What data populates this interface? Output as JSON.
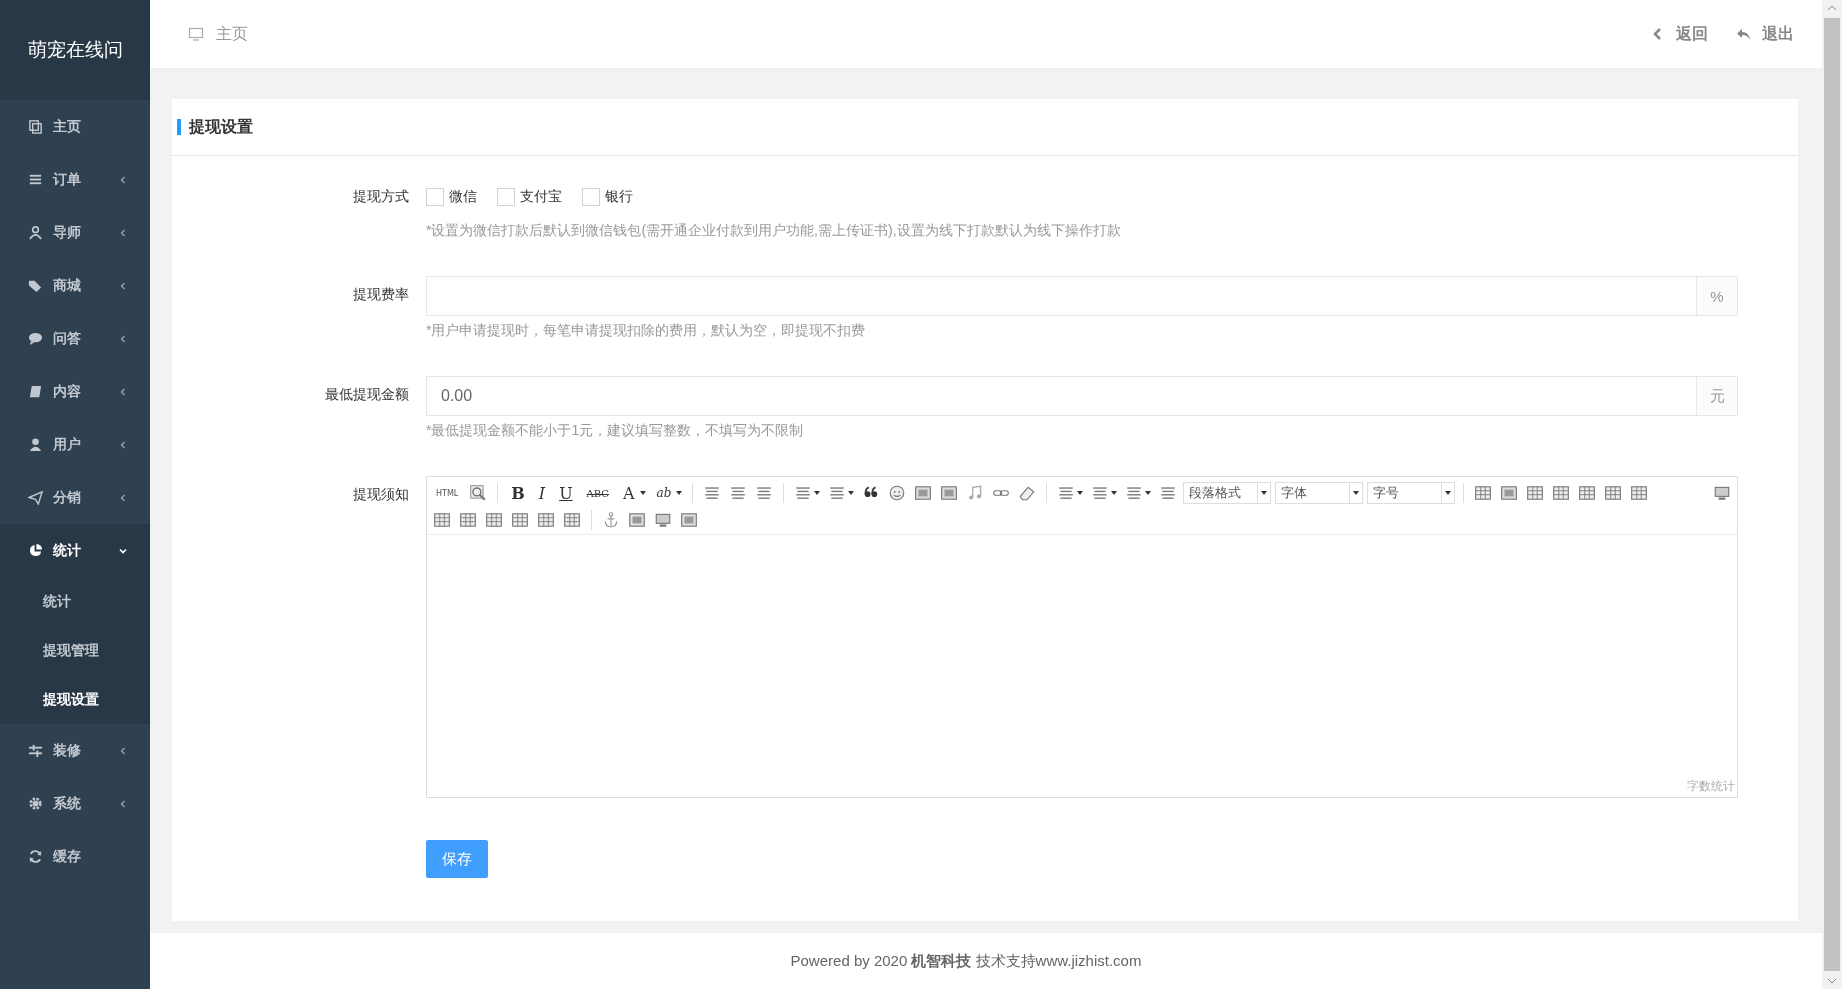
{
  "sidebar": {
    "brand": "萌宠在线问",
    "items": [
      {
        "label": "主页",
        "expandable": false,
        "selected": false
      },
      {
        "label": "订单",
        "expandable": true,
        "expanded": false,
        "selected": false
      },
      {
        "label": "导师",
        "expandable": true,
        "expanded": false,
        "selected": false
      },
      {
        "label": "商城",
        "expandable": true,
        "expanded": false,
        "selected": false
      },
      {
        "label": "问答",
        "expandable": true,
        "expanded": false,
        "selected": false
      },
      {
        "label": "内容",
        "expandable": true,
        "expanded": false,
        "selected": false
      },
      {
        "label": "用户",
        "expandable": true,
        "expanded": false,
        "selected": false
      },
      {
        "label": "分销",
        "expandable": true,
        "expanded": false,
        "selected": false
      },
      {
        "label": "统计",
        "expandable": true,
        "expanded": true,
        "selected": true,
        "children": [
          {
            "label": "统计",
            "selected": false
          },
          {
            "label": "提现管理",
            "selected": false
          },
          {
            "label": "提现设置",
            "selected": true
          }
        ]
      },
      {
        "label": "装修",
        "expandable": true,
        "expanded": false,
        "selected": false
      },
      {
        "label": "系统",
        "expandable": true,
        "expanded": false,
        "selected": false
      },
      {
        "label": "缓存",
        "expandable": false,
        "selected": false
      }
    ]
  },
  "header": {
    "breadcrumb": "主页",
    "back": "返回",
    "logout": "退出"
  },
  "card": {
    "title": "提现设置",
    "method": {
      "label": "提现方式",
      "options": [
        {
          "label": "微信",
          "checked": false
        },
        {
          "label": "支付宝",
          "checked": false
        },
        {
          "label": "银行",
          "checked": false
        }
      ],
      "hint": "*设置为微信打款后默认到微信钱包(需开通企业付款到用户功能,需上传证书),设置为线下打款默认为线下操作打款"
    },
    "fee": {
      "label": "提现费率",
      "suffix": "%",
      "hint": "*用户申请提现时，每笔申请提现扣除的费用，默认为空，即提现不扣费"
    },
    "min": {
      "label": "最低提现金额",
      "value": "0.00",
      "suffix": "元",
      "hint": "*最低提现金额不能小于1元，建议填写整数，不填写为不限制"
    },
    "notice": {
      "label": "提现须知",
      "word_count": "字数统计",
      "toolbar": [
        [
          {
            "kind": "glyph",
            "text": "HTML"
          },
          {
            "kind": "icon"
          },
          {
            "kind": "sep"
          },
          {
            "kind": "glyph",
            "text": "B"
          },
          {
            "kind": "glyph",
            "text": "I"
          },
          {
            "kind": "glyph",
            "text": "U"
          },
          {
            "kind": "glyph",
            "text": "ABC"
          },
          {
            "kind": "glyph",
            "text": "A",
            "caret": true
          },
          {
            "kind": "glyph",
            "text": "ab",
            "caret": true
          },
          {
            "kind": "sep"
          },
          {
            "kind": "icon"
          },
          {
            "kind": "icon"
          },
          {
            "kind": "icon"
          },
          {
            "kind": "sep"
          },
          {
            "kind": "icon",
            "caret": true
          },
          {
            "kind": "icon",
            "caret": true
          },
          {
            "kind": "icon"
          },
          {
            "kind": "icon"
          },
          {
            "kind": "icon"
          },
          {
            "kind": "icon"
          },
          {
            "kind": "icon"
          },
          {
            "kind": "icon"
          },
          {
            "kind": "icon"
          },
          {
            "kind": "sep"
          },
          {
            "kind": "icon",
            "caret": true
          },
          {
            "kind": "icon",
            "caret": true
          },
          {
            "kind": "icon",
            "caret": true
          },
          {
            "kind": "icon"
          },
          {
            "kind": "dropdown",
            "text": "段落格式"
          },
          {
            "kind": "dropdown",
            "text": "字体"
          },
          {
            "kind": "dropdown",
            "text": "字号"
          },
          {
            "kind": "sep"
          },
          {
            "kind": "icon"
          },
          {
            "kind": "icon"
          },
          {
            "kind": "icon"
          },
          {
            "kind": "icon"
          },
          {
            "kind": "icon"
          },
          {
            "kind": "icon"
          },
          {
            "kind": "icon"
          },
          {
            "kind": "spacer"
          },
          {
            "kind": "icon"
          }
        ],
        [
          {
            "kind": "icon"
          },
          {
            "kind": "icon"
          },
          {
            "kind": "icon"
          },
          {
            "kind": "icon"
          },
          {
            "kind": "icon"
          },
          {
            "kind": "icon"
          },
          {
            "kind": "sep"
          },
          {
            "kind": "icon"
          },
          {
            "kind": "icon"
          },
          {
            "kind": "icon"
          },
          {
            "kind": "icon"
          }
        ]
      ]
    },
    "save": "保存"
  },
  "footer": {
    "text": "Powered by 2020 **机智科技** 技术支持www.jizhist.com"
  }
}
